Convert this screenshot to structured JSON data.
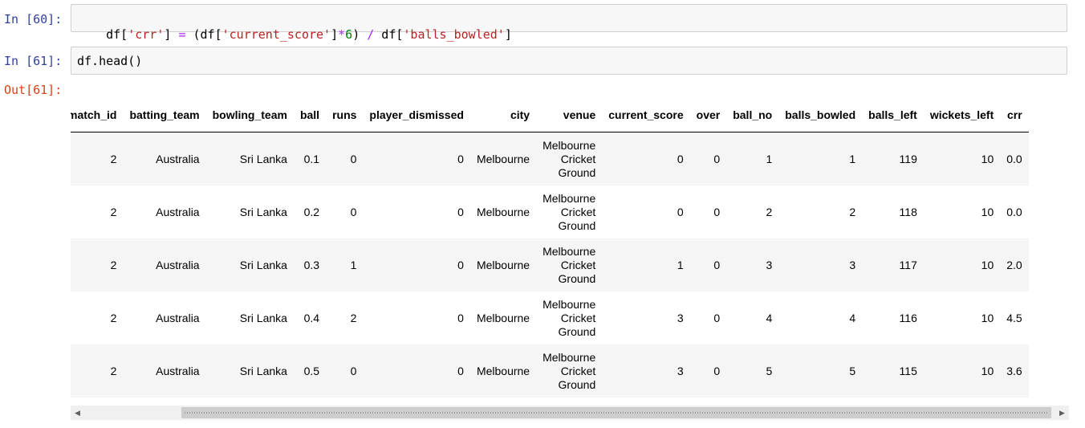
{
  "cells": [
    {
      "prompt": "In [60]:",
      "code_tokens": [
        "df[",
        "'crr'",
        "] ",
        "=",
        " (df[",
        "'current_score'",
        "]",
        "*",
        "6",
        ") ",
        "/",
        " df[",
        "'balls_bowled'",
        "]"
      ]
    },
    {
      "prompt": "In [61]:",
      "code_tokens": [
        "df.head()"
      ]
    }
  ],
  "output": {
    "prompt": "Out[61]:",
    "columns": [
      "match_id",
      "batting_team",
      "bowling_team",
      "ball",
      "runs",
      "player_dismissed",
      "city",
      "venue",
      "current_score",
      "over",
      "ball_no",
      "balls_bowled",
      "balls_left",
      "wickets_left",
      "crr"
    ],
    "rows": [
      [
        "2",
        "Australia",
        "Sri Lanka",
        "0.1",
        "0",
        "0",
        "Melbourne",
        [
          "Melbourne",
          "Cricket",
          "Ground"
        ],
        "0",
        "0",
        "1",
        "1",
        "119",
        "10",
        "0.0"
      ],
      [
        "2",
        "Australia",
        "Sri Lanka",
        "0.2",
        "0",
        "0",
        "Melbourne",
        [
          "Melbourne",
          "Cricket",
          "Ground"
        ],
        "0",
        "0",
        "2",
        "2",
        "118",
        "10",
        "0.0"
      ],
      [
        "2",
        "Australia",
        "Sri Lanka",
        "0.3",
        "1",
        "0",
        "Melbourne",
        [
          "Melbourne",
          "Cricket",
          "Ground"
        ],
        "1",
        "0",
        "3",
        "3",
        "117",
        "10",
        "2.0"
      ],
      [
        "2",
        "Australia",
        "Sri Lanka",
        "0.4",
        "2",
        "0",
        "Melbourne",
        [
          "Melbourne",
          "Cricket",
          "Ground"
        ],
        "3",
        "0",
        "4",
        "4",
        "116",
        "10",
        "4.5"
      ],
      [
        "2",
        "Australia",
        "Sri Lanka",
        "0.5",
        "0",
        "0",
        "Melbourne",
        [
          "Melbourne",
          "Cricket",
          "Ground"
        ],
        "3",
        "0",
        "5",
        "5",
        "115",
        "10",
        "3.6"
      ]
    ]
  },
  "scrollbar": {
    "left_arrow": "◀",
    "right_arrow": "▶"
  }
}
